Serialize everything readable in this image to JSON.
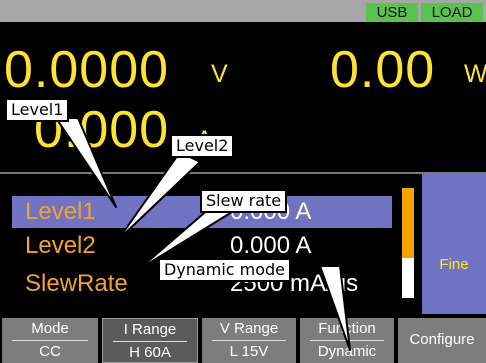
{
  "status_bar": {
    "badges": [
      "USB",
      "LOAD"
    ]
  },
  "measurements": {
    "voltage": {
      "value": "0.0000",
      "unit": "V"
    },
    "power": {
      "value": "0.00",
      "unit": "W"
    },
    "current": {
      "value": "0.000",
      "unit": "A"
    }
  },
  "settings": {
    "rows": [
      {
        "label": "Level1",
        "value": "0.000 A",
        "selected": true
      },
      {
        "label": "Level2",
        "value": "0.000 A",
        "selected": false
      },
      {
        "label": "SlewRate",
        "value": "2500 mA/us",
        "selected": false
      }
    ],
    "resolution": "Fine"
  },
  "softkeys": [
    {
      "top": "Mode",
      "bottom": "CC"
    },
    {
      "top": "I Range",
      "bottom": "H 60A",
      "active": true
    },
    {
      "top": "V Range",
      "bottom": "L 15V"
    },
    {
      "top": "Function",
      "bottom": "Dynamic"
    },
    {
      "single": "Configure"
    }
  ],
  "callouts": [
    "Level1",
    "Level2",
    "Slew rate",
    "Dynamic mode"
  ],
  "colors": {
    "measurement": "#ffe232",
    "label": "#f2a232",
    "selection": "#6f73c2",
    "status_badge": "#5ac24e"
  }
}
